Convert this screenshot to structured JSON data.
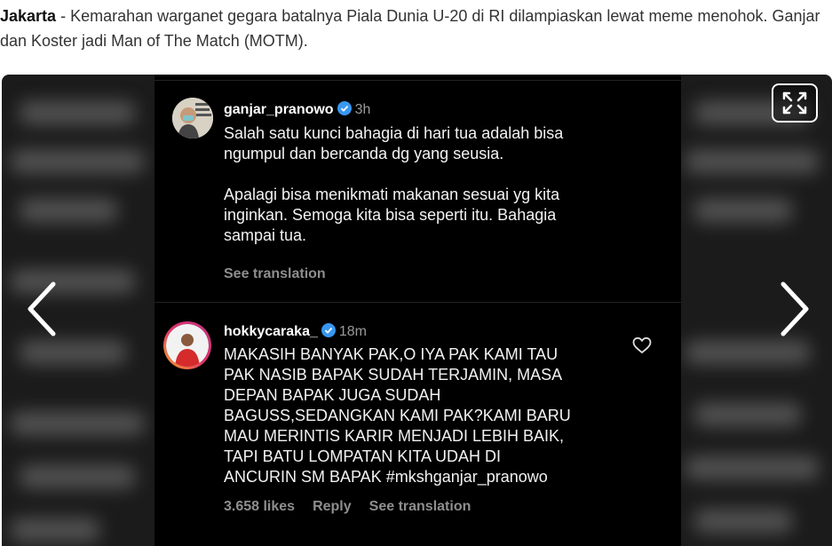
{
  "article": {
    "dateline": "Jakarta",
    "separator": " - ",
    "lead_text": "Kemarahan warganet gegara batalnya Piala Dunia U-20 di RI dilampiaskan lewat meme menohok. Ganjar dan Koster jadi Man of The Match (MOTM)."
  },
  "colors": {
    "accent_verified": "#3897f0",
    "story_ring": "#e1306c",
    "background_dark": "#000000"
  },
  "icons": {
    "expand": "expand-icon",
    "prev": "chevron-left-icon",
    "next": "chevron-right-icon",
    "verified": "verified-badge-icon",
    "like": "heart-icon"
  },
  "comments": [
    {
      "username": "ganjar_pranowo",
      "time": "3h",
      "text": "Salah satu kunci bahagia di hari tua adalah bisa\nngumpul dan bercanda dg yang seusia.\n\nApalagi bisa menikmati makanan sesuai yg kita\ninginkan. Semoga kita bisa seperti itu. Bahagia\nsampai tua.",
      "see_translation": "See translation"
    },
    {
      "username": "hokkycaraka_",
      "time": "18m",
      "text": "MAKASIH BANYAK PAK,O IYA PAK KAMI TAU\nPAK NASIB BAPAK SUDAH TERJAMIN, MASA\nDEPAN BAPAK JUGA SUDAH\nBAGUSS,SEDANGKAN KAMI PAK?KAMI BARU\nMAU MERINTIS KARIR MENJADI LEBIH BAIK,\nTAPI BATU LOMPATAN KITA UDAH DI\nANCURIN SM BAPAK #mkshganjar_pranowo",
      "likes": "3.658 likes",
      "reply": "Reply",
      "see_translation": "See translation"
    }
  ]
}
